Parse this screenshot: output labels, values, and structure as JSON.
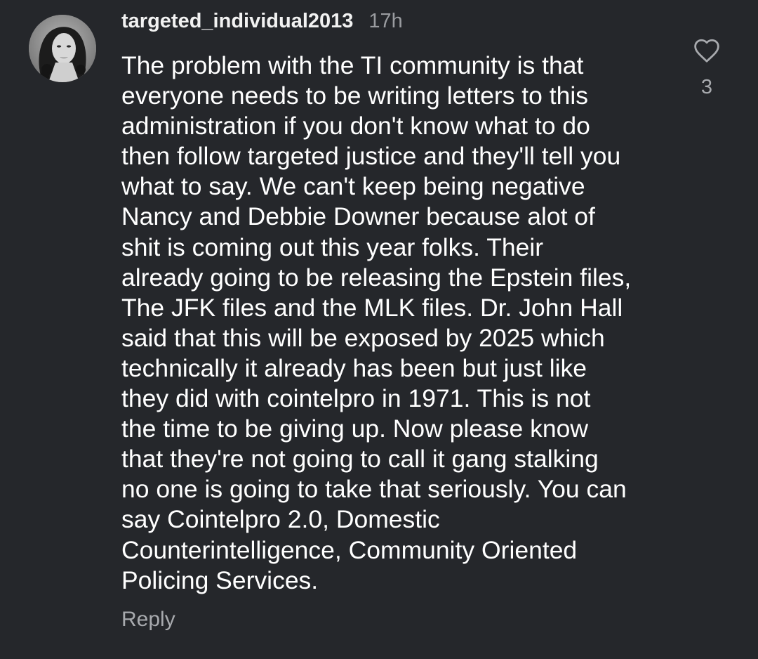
{
  "comment": {
    "username": "targeted_individual2013",
    "timestamp": "17h",
    "text": "The problem with the TI community is that\neveryone needs to be writing letters to this\nadministration if you don't know what to do\nthen follow targeted justice and they'll tell you\nwhat to say. We can't keep being negative\nNancy and Debbie Downer because alot of\nshit is coming out this year folks. Their\nalready going to be releasing the Epstein files,\nThe JFK files and the MLK files. Dr. John Hall\nsaid that this will be exposed by 2025 which\ntechnically it already has been but just like\nthey did with cointelpro in 1971. This is not\nthe time to be giving up. Now please know\nthat they're not going to call it gang stalking\nno one is going to take that seriously. You can\nsay Cointelpro 2.0,  Domestic\nCounterintelligence, Community Oriented\nPolicing Services.",
    "reply_label": "Reply",
    "like_count": "3",
    "like_icon": "heart-outline-icon",
    "avatar_icon": "user-avatar"
  },
  "colors": {
    "background": "#25272b",
    "text_primary": "#ffffff",
    "text_secondary": "#a8aaae",
    "timestamp": "#9a9ca0"
  }
}
